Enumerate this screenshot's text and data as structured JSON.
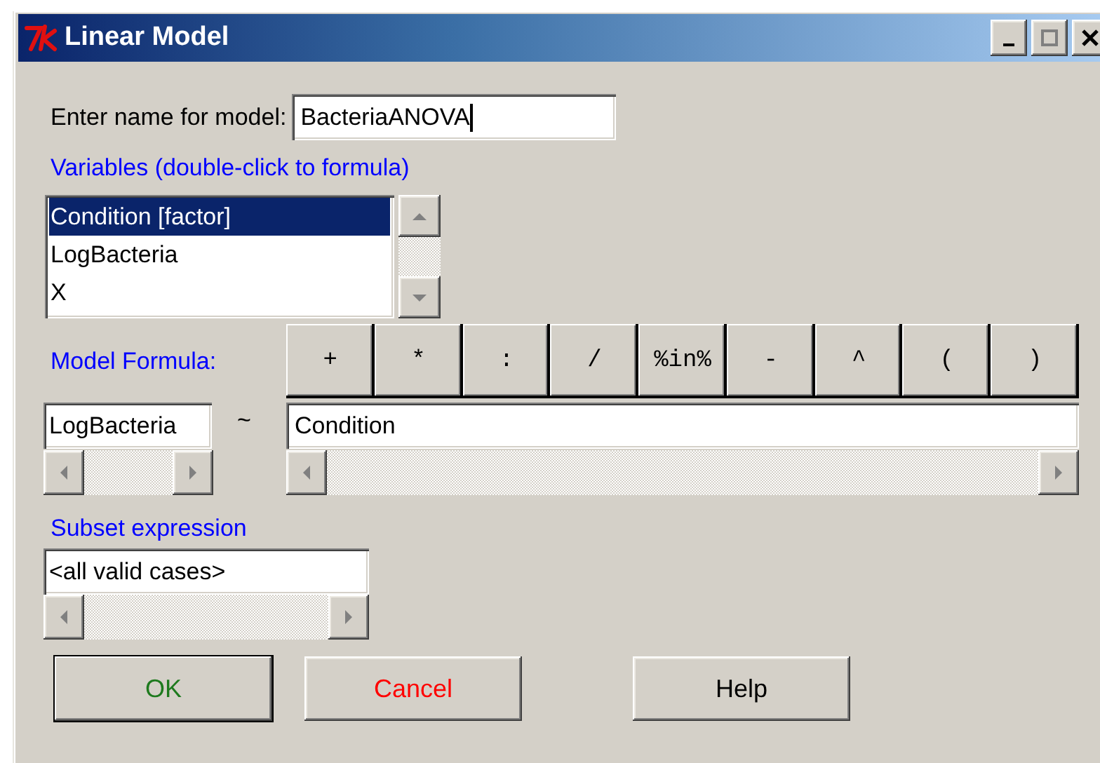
{
  "window": {
    "title": "Linear Model"
  },
  "model_name": {
    "label": "Enter name for model:",
    "value": "BacteriaANOVA"
  },
  "variables": {
    "label": "Variables (double-click to formula)",
    "items": [
      {
        "text": "Condition [factor]",
        "selected": true
      },
      {
        "text": "LogBacteria",
        "selected": false
      },
      {
        "text": "X",
        "selected": false
      }
    ]
  },
  "model_formula": {
    "label": "Model Formula:",
    "operators": [
      "+",
      "*",
      ":",
      "/",
      "%in%",
      "-",
      "^",
      "(",
      ")"
    ],
    "lhs": "LogBacteria",
    "tilde": "~",
    "rhs": "Condition"
  },
  "subset": {
    "label": "Subset expression",
    "value": "<all valid cases>"
  },
  "buttons": [
    {
      "label": "OK",
      "color": "#1e7a1e",
      "default": true
    },
    {
      "label": "Cancel",
      "color": "#ff0000",
      "default": false
    },
    {
      "label": "Help",
      "color": "#000000",
      "default": false
    }
  ]
}
